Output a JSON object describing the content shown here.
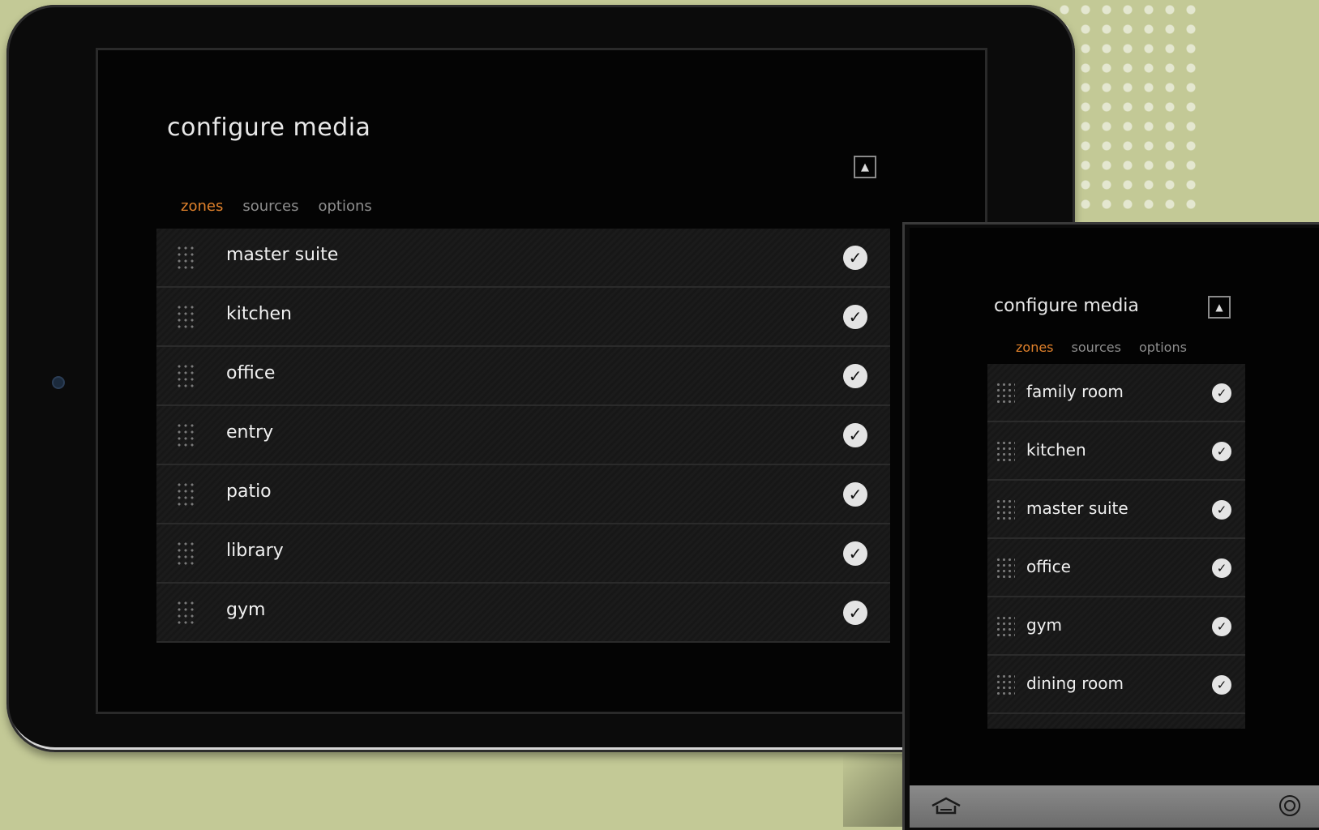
{
  "tablet": {
    "title": "configure media",
    "collapse_icon": "triangle-up-icon",
    "tabs": [
      {
        "label": "zones",
        "active": true
      },
      {
        "label": "sources",
        "active": false
      },
      {
        "label": "options",
        "active": false
      }
    ],
    "zones": [
      {
        "label": "master suite",
        "checked": true
      },
      {
        "label": "kitchen",
        "checked": true
      },
      {
        "label": "office",
        "checked": true
      },
      {
        "label": "entry",
        "checked": true
      },
      {
        "label": "patio",
        "checked": true
      },
      {
        "label": "library",
        "checked": true
      },
      {
        "label": "gym",
        "checked": true
      }
    ]
  },
  "phone": {
    "title": "configure media",
    "collapse_icon": "triangle-up-icon",
    "tabs": [
      {
        "label": "zones",
        "active": true
      },
      {
        "label": "sources",
        "active": false
      },
      {
        "label": "options",
        "active": false
      }
    ],
    "zones": [
      {
        "label": "family room",
        "checked": true
      },
      {
        "label": "kitchen",
        "checked": true
      },
      {
        "label": "master suite",
        "checked": true
      },
      {
        "label": "office",
        "checked": true
      },
      {
        "label": "gym",
        "checked": true
      },
      {
        "label": "dining room",
        "checked": true
      }
    ],
    "bottom_bar": {
      "home_icon": "home-icon",
      "power_icon": "power-icon"
    }
  },
  "colors": {
    "background": "#c3c996",
    "accent_active_tab": "#e0812b",
    "row": "#1b1b1b",
    "check": "#e4e4e4"
  }
}
